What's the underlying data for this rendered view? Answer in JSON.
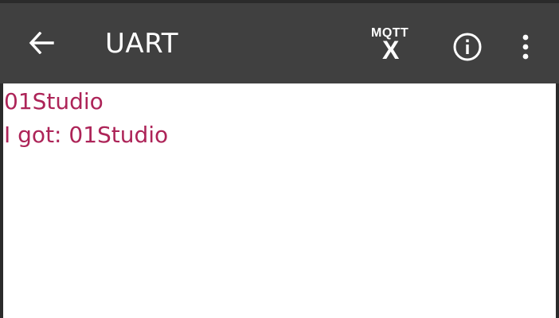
{
  "app_bar": {
    "title": "UART",
    "back_icon": "arrow-left-icon",
    "mqtt_logo_top": "MQTT",
    "mqtt_logo_bottom": "X",
    "info_icon": "info-circle-icon",
    "more_icon": "more-vertical-icon"
  },
  "messages": [
    {
      "text": "01Studio"
    },
    {
      "text": "I got: 01Studio"
    }
  ],
  "colors": {
    "app_bar": "#404040",
    "message_text": "#ad2458",
    "content_background": "#ffffff",
    "frame": "#2b2b2b"
  }
}
